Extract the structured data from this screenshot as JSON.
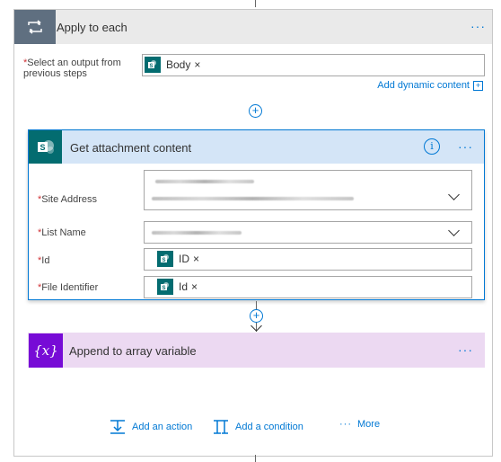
{
  "loop": {
    "title": "Apply to each",
    "more": "···",
    "select_label": "Select an output from previous steps",
    "required_mark": "*",
    "token_label": "Body",
    "token_remove": "×",
    "dynamic_link": "Add dynamic content",
    "dynamic_plus": "+"
  },
  "add_step_symbol": "+",
  "action_card": {
    "title": "Get attachment content",
    "info_symbol": "i",
    "more": "···",
    "icon_letter": "S",
    "fields": [
      {
        "label": "Site Address"
      },
      {
        "label": "List Name"
      },
      {
        "label": "Id",
        "token": "ID",
        "remove": "×"
      },
      {
        "label": "File Identifier",
        "token": "Id",
        "remove": "×"
      }
    ]
  },
  "variable_card": {
    "icon_text": "{x}",
    "title": "Append to array variable",
    "more": "···"
  },
  "footer": {
    "add_action": "Add an action",
    "add_condition": "Add a condition",
    "more_dots": "···",
    "more": "More"
  },
  "colors": {
    "accent": "#0078d4",
    "sharepoint": "#036c70",
    "variable": "#770bd6",
    "loop_header": "#5f6f80"
  }
}
